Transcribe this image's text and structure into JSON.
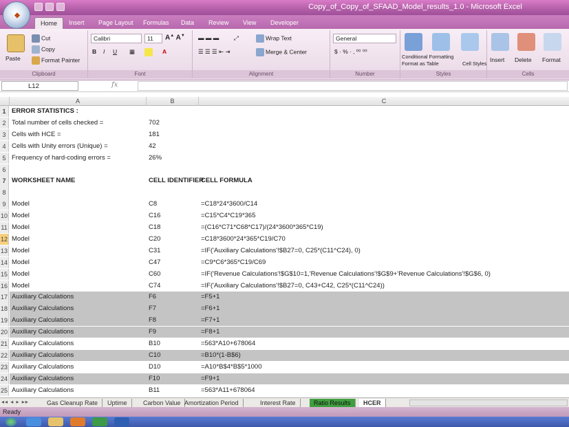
{
  "window": {
    "title": "Copy_of_Copy_of_SFAAD_Model_results_1.0 - Microsoft Excel",
    "app_logo_icon": "office-button-icon"
  },
  "ribbon_tabs": [
    "Home",
    "Insert",
    "Page Layout",
    "Formulas",
    "Data",
    "Review",
    "View",
    "Developer"
  ],
  "ribbon": {
    "clipboard": {
      "paste": "Paste",
      "cut": "Cut",
      "copy": "Copy",
      "format_painter": "Format Painter",
      "label": "Clipboard"
    },
    "font": {
      "name": "Calibri",
      "size": "11",
      "label": "Font"
    },
    "alignment": {
      "wrap": "Wrap Text",
      "merge": "Merge & Center",
      "label": "Alignment"
    },
    "number": {
      "format": "General",
      "label": "Number"
    },
    "styles": {
      "conditional": "Conditional Formatting",
      "format_table": "Format as Table",
      "cell_styles": "Cell Styles",
      "label": "Styles"
    },
    "cells": {
      "insert": "Insert",
      "delete": "Delete",
      "format": "Format",
      "label": "Cells"
    }
  },
  "formula_bar": {
    "name_box": "L12",
    "fx": "fx",
    "formula": ""
  },
  "columns": [
    "A",
    "B",
    "C"
  ],
  "rows": [
    {
      "n": "1",
      "a": "ERROR STATISTICS :",
      "b": "",
      "c": "",
      "bold": true
    },
    {
      "n": "2",
      "a": "Total number of cells checked =",
      "b": "702",
      "c": ""
    },
    {
      "n": "3",
      "a": "Cells with HCE =",
      "b": "181",
      "c": ""
    },
    {
      "n": "4",
      "a": "Cells with Unity errors (Unique) =",
      "b": "42",
      "c": ""
    },
    {
      "n": "5",
      "a": "Frequency of hard-coding errors =",
      "b": "26%",
      "c": ""
    },
    {
      "n": "6",
      "a": "",
      "b": "",
      "c": ""
    },
    {
      "n": "7",
      "a": "WORKSHEET NAME",
      "b": "CELL IDENTIFIER",
      "c": "CELL FORMULA",
      "bold": true
    },
    {
      "n": "8",
      "a": "",
      "b": "",
      "c": ""
    },
    {
      "n": "9",
      "a": "Model",
      "b": "C8",
      "c": "=C18*24*3600/C14"
    },
    {
      "n": "10",
      "a": "Model",
      "b": "C16",
      "c": "=C15*C4*C19*365"
    },
    {
      "n": "11",
      "a": "Model",
      "b": "C18",
      "c": "=(C16*C71*C68*C17)/(24*3600*365*C19)"
    },
    {
      "n": "12",
      "a": "Model",
      "b": "C20",
      "c": "=C18*3600*24*365*C19/C70"
    },
    {
      "n": "13",
      "a": "Model",
      "b": "C31",
      "c": "=IF('Auxiliary Calculations'!$B27=0, C25*(C11^C24), 0)"
    },
    {
      "n": "14",
      "a": "Model",
      "b": "C47",
      "c": "=C9*C6*365*C19/C69"
    },
    {
      "n": "15",
      "a": "Model",
      "b": "C60",
      "c": "=IF('Revenue Calculations'!$G$10=1,'Revenue Calculations'!$G$9+'Revenue Calculations'!$G$6, 0)"
    },
    {
      "n": "16",
      "a": "Model",
      "b": "C74",
      "c": "=IF('Auxiliary Calculations'!$B27=0, C43+C42, C25*(C11^C24))"
    },
    {
      "n": "17",
      "a": "Auxiliary Calculations",
      "b": "F6",
      "c": "=F5+1",
      "shaded": true
    },
    {
      "n": "18",
      "a": "Auxiliary Calculations",
      "b": "F7",
      "c": "=F6+1",
      "shaded": true
    },
    {
      "n": "19",
      "a": "Auxiliary Calculations",
      "b": "F8",
      "c": "=F7+1",
      "shaded": true
    },
    {
      "n": "20",
      "a": "Auxiliary Calculations",
      "b": "F9",
      "c": "=F8+1",
      "shaded": true
    },
    {
      "n": "21",
      "a": "Auxiliary Calculations",
      "b": "B10",
      "c": "=563*A10+678064"
    },
    {
      "n": "22",
      "a": "Auxiliary Calculations",
      "b": "C10",
      "c": "=B10*(1-B$6)",
      "shaded": true
    },
    {
      "n": "23",
      "a": "Auxiliary Calculations",
      "b": "D10",
      "c": "=A10*B$4*B$5*1000"
    },
    {
      "n": "24",
      "a": "Auxiliary Calculations",
      "b": "F10",
      "c": "=F9+1",
      "shaded": true
    },
    {
      "n": "25",
      "a": "Auxiliary Calculations",
      "b": "B11",
      "c": "=563*A11+678064"
    }
  ],
  "selected_row": "12",
  "sheet_tabs": [
    {
      "label": "Gas Cleanup Rate"
    },
    {
      "label": "Uptime"
    },
    {
      "label": "Carbon Value"
    },
    {
      "label": "Amortization Period"
    },
    {
      "label": "Interest Rate"
    },
    {
      "label": "Ratio Results",
      "green": true
    },
    {
      "label": "HCER",
      "active": true
    }
  ],
  "status": {
    "text": "Ready"
  },
  "colors": {
    "title_bar": "#b35fa8",
    "shaded_row": "#c4c4c4",
    "selected_row_header": "#f7cf7d",
    "green_tab": "#3f9f3f"
  }
}
